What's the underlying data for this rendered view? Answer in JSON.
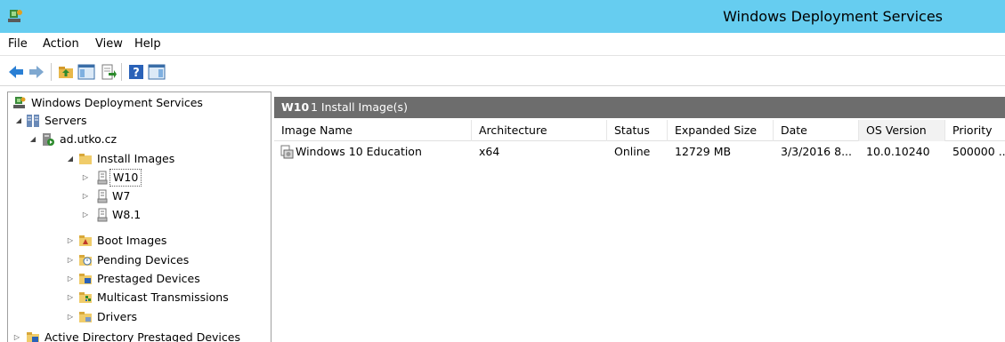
{
  "window": {
    "title": "Windows Deployment Services",
    "icon": "wds-server-icon"
  },
  "menu": {
    "file": "File",
    "action": "Action",
    "view": "View",
    "help": "Help"
  },
  "toolbar": {
    "icons": [
      "back-arrow-icon",
      "forward-arrow-icon",
      "up-folder-icon",
      "show-hide-tree-icon",
      "export-list-icon",
      "help-icon",
      "show-action-pane-icon"
    ]
  },
  "tree": {
    "root": "Windows Deployment Services",
    "servers": "Servers",
    "server": "ad.utko.cz",
    "install_images": "Install Images",
    "groups": [
      "W10",
      "W7",
      "W8.1"
    ],
    "boot_images": "Boot Images",
    "pending_devices": "Pending Devices",
    "prestaged_devices": "Prestaged Devices",
    "multicast": "Multicast Transmissions",
    "drivers": "Drivers",
    "ad_prestaged": "Active Directory Prestaged Devices"
  },
  "results": {
    "group_name": "W10",
    "count_text": "1 Install Image(s)",
    "columns": [
      "Image Name",
      "Architecture",
      "Status",
      "Expanded Size",
      "Date",
      "OS Version",
      "Priority"
    ],
    "rows": [
      [
        "Windows 10 Education",
        "x64",
        "Online",
        "12729 MB",
        "3/3/2016 8...",
        "10.0.10240",
        "500000 ..."
      ]
    ]
  },
  "colors": {
    "titlebar": "#66cdf0",
    "results_header": "#6d6d6d"
  }
}
